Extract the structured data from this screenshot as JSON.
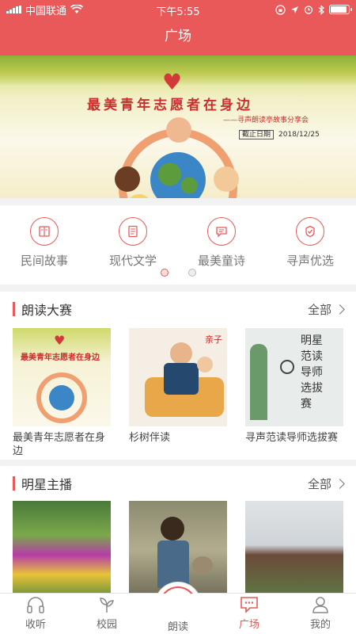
{
  "status": {
    "carrier": "中国联通",
    "time": "下午5:55"
  },
  "header": {
    "title": "广场"
  },
  "banner": {
    "title": "最美青年志愿者在身边",
    "subtitle": "——寻声朗读亭故事分享会",
    "deadline_label": "截止日期",
    "deadline_date": "2018/12/25"
  },
  "categories": [
    {
      "label": "民间故事",
      "icon": "book-icon"
    },
    {
      "label": "现代文学",
      "icon": "document-icon"
    },
    {
      "label": "最美童诗",
      "icon": "chat-icon"
    },
    {
      "label": "寻声优选",
      "icon": "badge-icon"
    }
  ],
  "category_pager": {
    "pages": 2,
    "current": 1
  },
  "sections": {
    "reading_contest": {
      "title": "朗读大赛",
      "more": "全部",
      "items": [
        {
          "label": "最美青年志愿者在身边"
        },
        {
          "label": "杉树伴读",
          "tag": "亲子"
        },
        {
          "label": "寻声范读导师选拔赛",
          "poster_text": "明星 范读导师 选拔赛"
        }
      ]
    },
    "star_hosts": {
      "title": "明星主播",
      "more": "全部"
    }
  },
  "tabbar": {
    "items": [
      {
        "label": "收听",
        "icon": "headphones-icon"
      },
      {
        "label": "校园",
        "icon": "sprout-icon"
      },
      {
        "label": "朗读",
        "icon": "microphone-icon"
      },
      {
        "label": "广场",
        "icon": "square-chat-icon",
        "active": true
      },
      {
        "label": "我的",
        "icon": "person-icon"
      }
    ]
  },
  "colors": {
    "accent": "#e9595a"
  }
}
